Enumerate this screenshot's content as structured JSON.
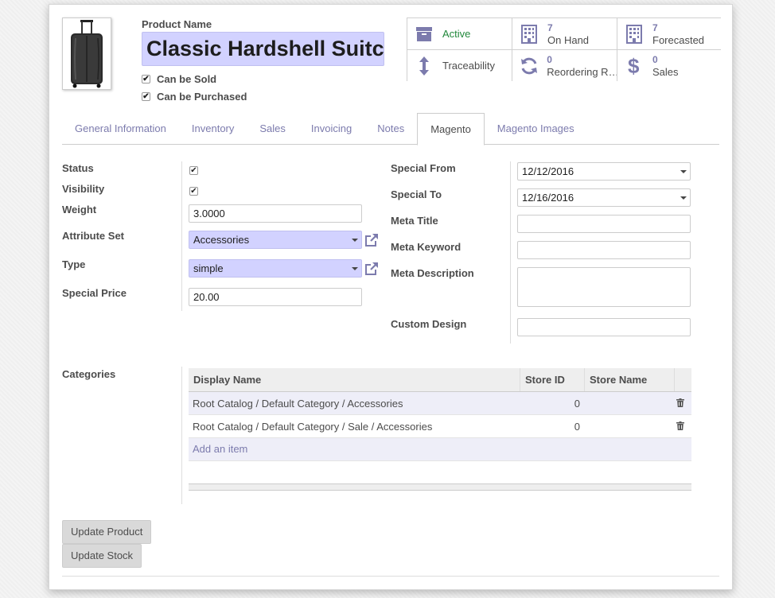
{
  "header": {
    "name_label": "Product Name",
    "product_name": "Classic Hardshell Suitcase",
    "can_be_sold": "Can be Sold",
    "can_be_purchased": "Can be Purchased"
  },
  "stats": [
    {
      "kind": "single",
      "label": "Active",
      "icon": "archive-icon"
    },
    {
      "kind": "double",
      "num": "7",
      "label": "On Hand",
      "icon": "building-icon"
    },
    {
      "kind": "double",
      "num": "7",
      "label": "Forecasted",
      "icon": "building-icon"
    },
    {
      "kind": "single",
      "label": "Traceability",
      "icon": "arrows-vertical-icon"
    },
    {
      "kind": "double",
      "num": "0",
      "label": "Reordering R…",
      "icon": "refresh-icon"
    },
    {
      "kind": "double",
      "num": "0",
      "label": "Sales",
      "icon": "dollar-icon"
    }
  ],
  "tabs": [
    "General Information",
    "Inventory",
    "Sales",
    "Invoicing",
    "Notes",
    "Magento",
    "Magento Images"
  ],
  "active_tab": "Magento",
  "left_fields": {
    "status": "Status",
    "visibility": "Visibility",
    "weight_label": "Weight",
    "weight": "3.0000",
    "attribute_set_label": "Attribute Set",
    "attribute_set": "Accessories",
    "type_label": "Type",
    "type": "simple",
    "special_price_label": "Special Price",
    "special_price": "20.00"
  },
  "right_fields": {
    "special_from_label": "Special From",
    "special_from": "12/12/2016",
    "special_to_label": "Special To",
    "special_to": "12/16/2016",
    "meta_title": "Meta Title",
    "meta_keyword": "Meta Keyword",
    "meta_description": "Meta Description",
    "custom_design": "Custom Design"
  },
  "categories": {
    "label": "Categories",
    "columns": [
      "Display Name",
      "Store ID",
      "Store Name"
    ],
    "rows": [
      {
        "display_name": "Root Catalog / Default Category / Accessories",
        "store_id": "0",
        "store_name": ""
      },
      {
        "display_name": "Root Catalog / Default Category / Sale / Accessories",
        "store_id": "0",
        "store_name": ""
      }
    ],
    "add_item": "Add an item"
  },
  "buttons": {
    "update_product": "Update Product",
    "update_stock": "Update Stock"
  },
  "colors": {
    "accent": "#7c7bad",
    "active_green": "#21883b",
    "required_bg": "#d2d2ff"
  }
}
